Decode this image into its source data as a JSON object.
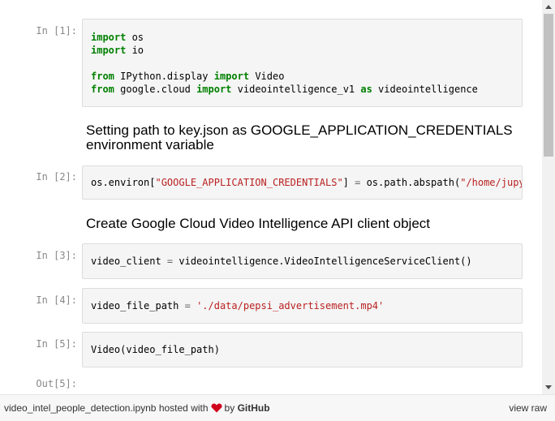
{
  "cells": [
    {
      "prompt": "In [1]:",
      "lines": [
        [
          {
            "t": "import",
            "c": "kw"
          },
          {
            "t": " os"
          }
        ],
        [
          {
            "t": "import",
            "c": "kw"
          },
          {
            "t": " io"
          }
        ],
        [],
        [
          {
            "t": "from",
            "c": "kw"
          },
          {
            "t": " IPython.display "
          },
          {
            "t": "import",
            "c": "kw"
          },
          {
            "t": " Video"
          }
        ],
        [
          {
            "t": "from",
            "c": "kw"
          },
          {
            "t": " google.cloud "
          },
          {
            "t": "import",
            "c": "kw"
          },
          {
            "t": " videointelligence_v1 "
          },
          {
            "t": "as",
            "c": "kw"
          },
          {
            "t": " videointelligence"
          }
        ]
      ]
    },
    {
      "prompt": "In [2]:",
      "lines": [
        [
          {
            "t": "os.environ["
          },
          {
            "t": "\"GOOGLE_APPLICATION_CREDENTIALS\"",
            "c": "str"
          },
          {
            "t": "] "
          },
          {
            "t": "=",
            "c": "op"
          },
          {
            "t": " os.path.abspath("
          },
          {
            "t": "\"/home/jupyter/key.json\"",
            "c": "str"
          },
          {
            "t": ")"
          }
        ]
      ]
    },
    {
      "prompt": "In [3]:",
      "lines": [
        [
          {
            "t": "video_client "
          },
          {
            "t": "=",
            "c": "op"
          },
          {
            "t": " videointelligence.VideoIntelligenceServiceClient()"
          }
        ]
      ]
    },
    {
      "prompt": "In [4]:",
      "lines": [
        [
          {
            "t": "video_file_path "
          },
          {
            "t": "=",
            "c": "op"
          },
          {
            "t": " "
          },
          {
            "t": "'./data/pepsi_advertisement.mp4'",
            "c": "str"
          }
        ]
      ]
    },
    {
      "prompt": "In [5]:",
      "lines": [
        [
          {
            "t": "Video(video_file_path)"
          }
        ]
      ]
    }
  ],
  "markdown": {
    "heading_1": "Setting path to key.json as GOOGLE_APPLICATION_CREDENTIALS environment variable",
    "heading_2": "Create Google Cloud Video Intelligence API client object"
  },
  "out_prompt": "Out[5]:",
  "footer": {
    "filename": "video_intel_people_detection.ipynb",
    "hosted_with": "hosted with",
    "by": "by",
    "github": "GitHub",
    "view_raw": "view raw",
    "heart_color": "#d0021b"
  }
}
